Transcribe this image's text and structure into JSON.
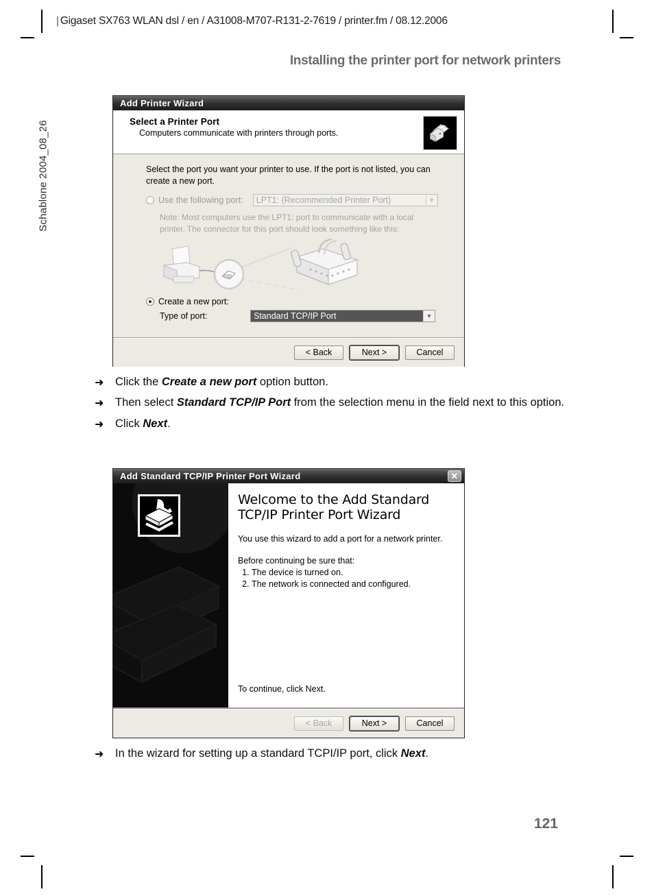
{
  "page": {
    "header_line": "Gigaset SX763 WLAN dsl / en / A31008-M707-R131-2-7619 / printer.fm / 08.12.2006",
    "section_title": "Installing the printer port for network printers",
    "side_label": "Schablone 2004_08_26",
    "page_number": "121"
  },
  "steps_first": [
    {
      "arrow": "➜",
      "html": "Click the <b>Create a new port</b> option button."
    },
    {
      "arrow": "➜",
      "html": "Then select <b>Standard TCP/IP Port</b> from the selection menu in the field next to this option."
    },
    {
      "arrow": "➜",
      "html": "Click <b>Next</b>."
    }
  ],
  "steps_second": [
    {
      "arrow": "➜",
      "html": "In the wizard for setting up a standard TCPI/IP port, click <b>Next</b>."
    }
  ],
  "dialog_add_printer": {
    "title": "Add Printer Wizard",
    "head_icon": "printer-icon",
    "heading": "Select a Printer Port",
    "subheading": "Computers communicate with printers through ports.",
    "lead": "Select the port you want your printer to use.  If the port is not listed, you can create a new port.",
    "option_use_port": {
      "label": "Use the following port:",
      "selected": false,
      "combo_value": "LPT1: (Recommended Printer Port)",
      "disabled": true
    },
    "note": "Note: Most computers use the LPT1: port to communicate with a local printer. The connector for this port should look something like this:",
    "illustration": "printer-and-parallel-connector-illustration",
    "option_create_port": {
      "label": "Create a new port:",
      "selected": true,
      "type_label": "Type of port:",
      "combo_value": "Standard TCP/IP Port"
    },
    "buttons": {
      "back": "< Back",
      "next": "Next >",
      "cancel": "Cancel"
    }
  },
  "dialog_tcpip": {
    "title": "Add Standard TCP/IP Printer Port Wizard",
    "close_label": "✕",
    "side_icon": "network-printer-icon",
    "welcome_heading": "Welcome to the Add Standard TCP/IP Printer Port Wizard",
    "intro": "You use this wizard to add a port for a network printer.",
    "before_label": "Before continuing be sure that:",
    "before_items": [
      "The device is turned on.",
      "The network is connected and configured."
    ],
    "continue_text": "To continue, click Next.",
    "buttons": {
      "back": "< Back",
      "next": "Next >",
      "cancel": "Cancel"
    }
  }
}
